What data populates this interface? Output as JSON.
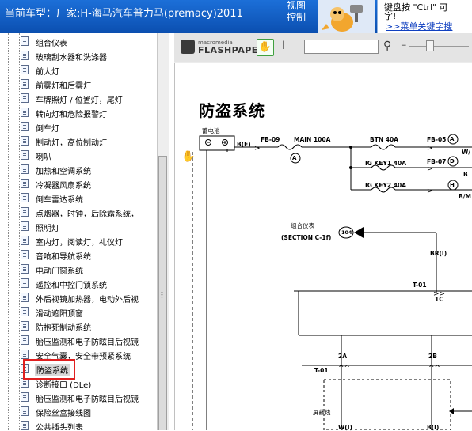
{
  "header": {
    "title": "当前车型：厂家:H-海马汽车普力马(premacy)2011",
    "view_control": [
      "视图",
      "控制"
    ],
    "ad_text_line1": "键盘按 \"Ctrl\"  可",
    "ad_text_line2": "字!",
    "ad_link": ">>菜单关键字搜"
  },
  "tree": {
    "items": [
      "组合仪表",
      "玻璃刮水器和洗涤器",
      "前大灯",
      "前雾灯和后雾灯",
      "车牌照灯 / 位置灯，尾灯",
      "转向灯和危险报警灯",
      "倒车灯",
      "制动灯，高位制动灯",
      "喇叭",
      "加热和空调系统",
      "冷凝器风扇系统",
      "倒车雷达系统",
      "点烟器，时钟，后除霜系统，",
      "照明灯",
      "室内灯，阅读灯，礼仪灯",
      "音响和导航系统",
      "电动门窗系统",
      "遥控和中控门锁系统",
      "外后视镜加热器，电动外后视",
      "滑动遮阳顶窗",
      "防抱死制动系统",
      "胎压监测和电子防眩目后视镜",
      "安全气囊，安全带预紧系统",
      "防盗系统",
      "诊断接口 (DLe)",
      "胎压监测和电子防眩目后视镜",
      "保险丝盒接线图",
      "公共插头列表"
    ],
    "selected": "防盗系统"
  },
  "viewer": {
    "brand_small": "macromedia",
    "brand_big": "FLASHPAPER",
    "search_value": "",
    "page_title": "防盗系统"
  },
  "diagram": {
    "battery_label": "蓄电池",
    "wire_be": "B(E)",
    "fb09": "FB-09",
    "main100": "MAIN 100A",
    "btn40": "BTN 40A",
    "igkey1": "IG KEY1  40A",
    "igkey2": "IG KEY2  40A",
    "fb05": "FB-05",
    "fb07": "FB-07",
    "circle_a": "A",
    "circle_d": "D",
    "circle_h": "H",
    "circle_a2": "A",
    "w_label": "W/",
    "b_label": "B",
    "bm_label": "B/M",
    "cluster_label": "组合仪表",
    "section_ref": "(SECTION C-1f)",
    "conn_104": "104",
    "br_label": "BR(I)",
    "t01_a": "T-01",
    "c1": "1C",
    "a2": "2A",
    "b2": "2B",
    "t01_b": "T-01",
    "shield_label": "屏蔽线",
    "w_i": "W(I)",
    "b_i": "B(I)"
  }
}
